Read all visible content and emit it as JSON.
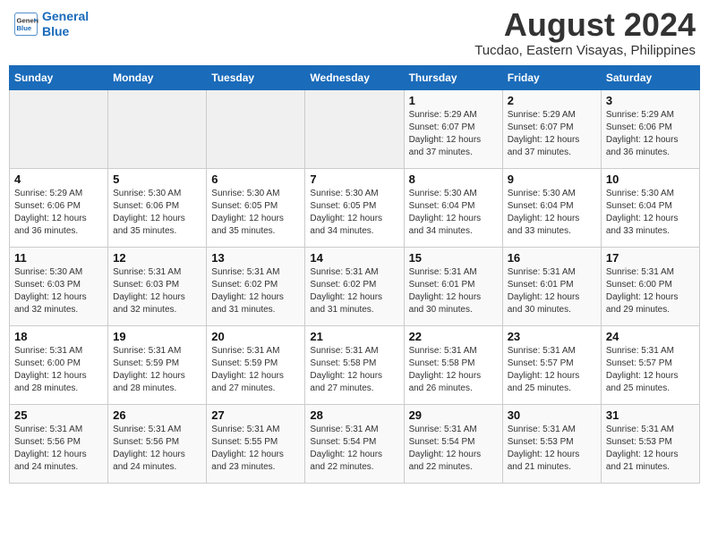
{
  "header": {
    "logo_line1": "General",
    "logo_line2": "Blue",
    "month_title": "August 2024",
    "location": "Tucdao, Eastern Visayas, Philippines"
  },
  "weekdays": [
    "Sunday",
    "Monday",
    "Tuesday",
    "Wednesday",
    "Thursday",
    "Friday",
    "Saturday"
  ],
  "weeks": [
    [
      {
        "day": "",
        "info": ""
      },
      {
        "day": "",
        "info": ""
      },
      {
        "day": "",
        "info": ""
      },
      {
        "day": "",
        "info": ""
      },
      {
        "day": "1",
        "info": "Sunrise: 5:29 AM\nSunset: 6:07 PM\nDaylight: 12 hours\nand 37 minutes."
      },
      {
        "day": "2",
        "info": "Sunrise: 5:29 AM\nSunset: 6:07 PM\nDaylight: 12 hours\nand 37 minutes."
      },
      {
        "day": "3",
        "info": "Sunrise: 5:29 AM\nSunset: 6:06 PM\nDaylight: 12 hours\nand 36 minutes."
      }
    ],
    [
      {
        "day": "4",
        "info": "Sunrise: 5:29 AM\nSunset: 6:06 PM\nDaylight: 12 hours\nand 36 minutes."
      },
      {
        "day": "5",
        "info": "Sunrise: 5:30 AM\nSunset: 6:06 PM\nDaylight: 12 hours\nand 35 minutes."
      },
      {
        "day": "6",
        "info": "Sunrise: 5:30 AM\nSunset: 6:05 PM\nDaylight: 12 hours\nand 35 minutes."
      },
      {
        "day": "7",
        "info": "Sunrise: 5:30 AM\nSunset: 6:05 PM\nDaylight: 12 hours\nand 34 minutes."
      },
      {
        "day": "8",
        "info": "Sunrise: 5:30 AM\nSunset: 6:04 PM\nDaylight: 12 hours\nand 34 minutes."
      },
      {
        "day": "9",
        "info": "Sunrise: 5:30 AM\nSunset: 6:04 PM\nDaylight: 12 hours\nand 33 minutes."
      },
      {
        "day": "10",
        "info": "Sunrise: 5:30 AM\nSunset: 6:04 PM\nDaylight: 12 hours\nand 33 minutes."
      }
    ],
    [
      {
        "day": "11",
        "info": "Sunrise: 5:30 AM\nSunset: 6:03 PM\nDaylight: 12 hours\nand 32 minutes."
      },
      {
        "day": "12",
        "info": "Sunrise: 5:31 AM\nSunset: 6:03 PM\nDaylight: 12 hours\nand 32 minutes."
      },
      {
        "day": "13",
        "info": "Sunrise: 5:31 AM\nSunset: 6:02 PM\nDaylight: 12 hours\nand 31 minutes."
      },
      {
        "day": "14",
        "info": "Sunrise: 5:31 AM\nSunset: 6:02 PM\nDaylight: 12 hours\nand 31 minutes."
      },
      {
        "day": "15",
        "info": "Sunrise: 5:31 AM\nSunset: 6:01 PM\nDaylight: 12 hours\nand 30 minutes."
      },
      {
        "day": "16",
        "info": "Sunrise: 5:31 AM\nSunset: 6:01 PM\nDaylight: 12 hours\nand 30 minutes."
      },
      {
        "day": "17",
        "info": "Sunrise: 5:31 AM\nSunset: 6:00 PM\nDaylight: 12 hours\nand 29 minutes."
      }
    ],
    [
      {
        "day": "18",
        "info": "Sunrise: 5:31 AM\nSunset: 6:00 PM\nDaylight: 12 hours\nand 28 minutes."
      },
      {
        "day": "19",
        "info": "Sunrise: 5:31 AM\nSunset: 5:59 PM\nDaylight: 12 hours\nand 28 minutes."
      },
      {
        "day": "20",
        "info": "Sunrise: 5:31 AM\nSunset: 5:59 PM\nDaylight: 12 hours\nand 27 minutes."
      },
      {
        "day": "21",
        "info": "Sunrise: 5:31 AM\nSunset: 5:58 PM\nDaylight: 12 hours\nand 27 minutes."
      },
      {
        "day": "22",
        "info": "Sunrise: 5:31 AM\nSunset: 5:58 PM\nDaylight: 12 hours\nand 26 minutes."
      },
      {
        "day": "23",
        "info": "Sunrise: 5:31 AM\nSunset: 5:57 PM\nDaylight: 12 hours\nand 25 minutes."
      },
      {
        "day": "24",
        "info": "Sunrise: 5:31 AM\nSunset: 5:57 PM\nDaylight: 12 hours\nand 25 minutes."
      }
    ],
    [
      {
        "day": "25",
        "info": "Sunrise: 5:31 AM\nSunset: 5:56 PM\nDaylight: 12 hours\nand 24 minutes."
      },
      {
        "day": "26",
        "info": "Sunrise: 5:31 AM\nSunset: 5:56 PM\nDaylight: 12 hours\nand 24 minutes."
      },
      {
        "day": "27",
        "info": "Sunrise: 5:31 AM\nSunset: 5:55 PM\nDaylight: 12 hours\nand 23 minutes."
      },
      {
        "day": "28",
        "info": "Sunrise: 5:31 AM\nSunset: 5:54 PM\nDaylight: 12 hours\nand 22 minutes."
      },
      {
        "day": "29",
        "info": "Sunrise: 5:31 AM\nSunset: 5:54 PM\nDaylight: 12 hours\nand 22 minutes."
      },
      {
        "day": "30",
        "info": "Sunrise: 5:31 AM\nSunset: 5:53 PM\nDaylight: 12 hours\nand 21 minutes."
      },
      {
        "day": "31",
        "info": "Sunrise: 5:31 AM\nSunset: 5:53 PM\nDaylight: 12 hours\nand 21 minutes."
      }
    ]
  ]
}
